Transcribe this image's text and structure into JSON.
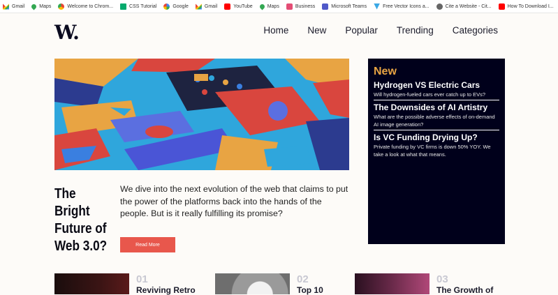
{
  "bookmarks": [
    {
      "label": "Gmail",
      "icon": "gmail-icon"
    },
    {
      "label": "Maps",
      "icon": "maps-icon"
    },
    {
      "label": "Welcome to Chrom...",
      "icon": "chrome-icon"
    },
    {
      "label": "CSS Tutorial",
      "icon": "w3schools-icon"
    },
    {
      "label": "Google",
      "icon": "google-icon"
    },
    {
      "label": "Gmail",
      "icon": "gmail-icon"
    },
    {
      "label": "YouTube",
      "icon": "youtube-icon"
    },
    {
      "label": "Maps",
      "icon": "maps-icon"
    },
    {
      "label": "Business",
      "icon": "business-icon"
    },
    {
      "label": "Microsoft Teams",
      "icon": "teams-icon"
    },
    {
      "label": "Free Vector Icons a...",
      "icon": "vector-icon"
    },
    {
      "label": "Cite a Website - Cit...",
      "icon": "cite-icon"
    },
    {
      "label": "How To Download I...",
      "icon": "youtube-icon"
    }
  ],
  "header": {
    "logo": "W.",
    "nav": [
      "Home",
      "New",
      "Popular",
      "Trending",
      "Categories"
    ]
  },
  "hero": {
    "title": "The Bright Future of Web 3.0?",
    "description": "We dive into the next evolution of the web that claims to put the power of the platforms back into the hands of the people. But is it really fulfilling its promise?",
    "button_label": "Read More"
  },
  "new_panel": {
    "heading": "New",
    "items": [
      {
        "title": "Hydrogen VS Electric Cars",
        "desc": "Will hydrogen-fueled cars ever catch up to EVs?"
      },
      {
        "title": "The Downsides of AI Artistry",
        "desc": "What are the possible adverse effects of on-demand AI image generation?"
      },
      {
        "title": "Is VC Funding Drying Up?",
        "desc": "Private funding by VC firms is down 50% YOY. We take a look at what that means."
      }
    ]
  },
  "cards": [
    {
      "number": "01",
      "title": "Reviving Retro"
    },
    {
      "number": "02",
      "title": "Top 10"
    },
    {
      "number": "03",
      "title": "The Growth of"
    }
  ],
  "colors": {
    "accent_orange": "#e8a443",
    "button_red": "#e8574c",
    "panel_navy": "#00001b",
    "page_bg": "#fdfbf8"
  }
}
